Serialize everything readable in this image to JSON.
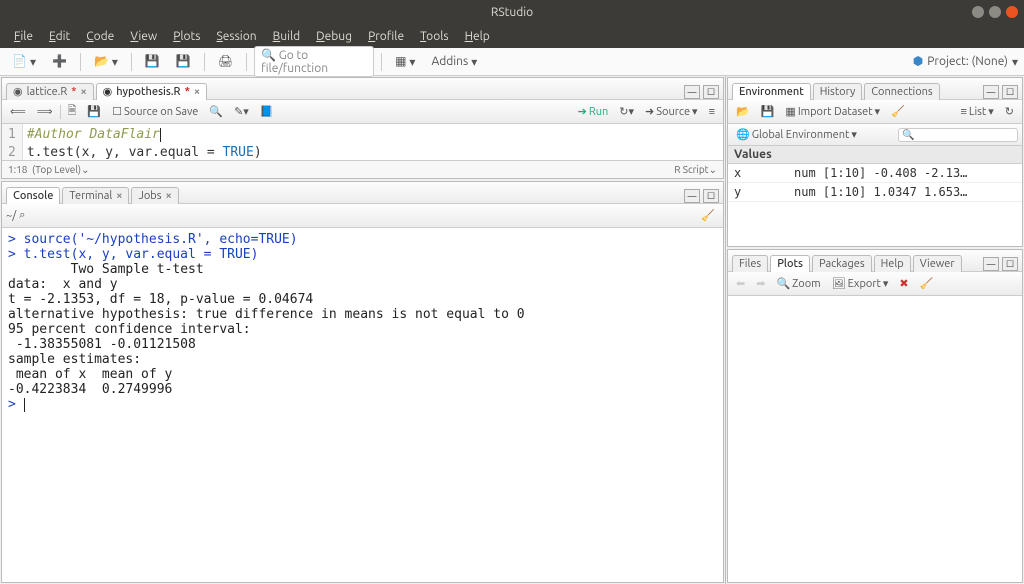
{
  "window": {
    "title": "RStudio"
  },
  "menu": [
    "File",
    "Edit",
    "Code",
    "View",
    "Plots",
    "Session",
    "Build",
    "Debug",
    "Profile",
    "Tools",
    "Help"
  ],
  "toolbar": {
    "goto_placeholder": "Go to file/function",
    "addins": "Addins",
    "project": "Project: (None)"
  },
  "source": {
    "tabs": [
      {
        "label": "lattice.R",
        "dirty": true,
        "active": false
      },
      {
        "label": "hypothesis.R",
        "dirty": true,
        "active": true
      }
    ],
    "panebar": {
      "source_on_save": "Source on Save",
      "run": "Run",
      "source_btn": "Source"
    },
    "lines": [
      {
        "n": "1",
        "cls": "comment",
        "text": "#Author DataFlair"
      },
      {
        "n": "2",
        "cls": "",
        "text": "t.test(x, y, var.equal = TRUE)"
      }
    ],
    "status_left": "1:18",
    "status_mid": "(Top Level)",
    "status_right": "R Script"
  },
  "console": {
    "tabs": [
      "Console",
      "Terminal",
      "Jobs"
    ],
    "prompt_path": "~/",
    "lines": [
      {
        "cls": "blue",
        "text": "> source('~/hypothesis.R', echo=TRUE)"
      },
      {
        "cls": "",
        "text": ""
      },
      {
        "cls": "blue",
        "text": "> t.test(x, y, var.equal = TRUE)"
      },
      {
        "cls": "",
        "text": ""
      },
      {
        "cls": "",
        "text": "\tTwo Sample t-test"
      },
      {
        "cls": "",
        "text": ""
      },
      {
        "cls": "",
        "text": "data:  x and y"
      },
      {
        "cls": "",
        "text": "t = -2.1353, df = 18, p-value = 0.04674"
      },
      {
        "cls": "",
        "text": "alternative hypothesis: true difference in means is not equal to 0"
      },
      {
        "cls": "",
        "text": "95 percent confidence interval:"
      },
      {
        "cls": "",
        "text": " -1.38355081 -0.01121508"
      },
      {
        "cls": "",
        "text": "sample estimates:"
      },
      {
        "cls": "",
        "text": " mean of x  mean of y "
      },
      {
        "cls": "",
        "text": "-0.4223834  0.2749996 "
      },
      {
        "cls": "",
        "text": ""
      },
      {
        "cls": "blue",
        "text": "> "
      }
    ]
  },
  "env": {
    "tabs": [
      "Environment",
      "History",
      "Connections"
    ],
    "import": "Import Dataset",
    "list": "List",
    "scope": "Global Environment",
    "search_placeholder": "",
    "section": "Values",
    "rows": [
      {
        "name": "x",
        "value": "num [1:10] -0.408 -2.13…"
      },
      {
        "name": "y",
        "value": "num [1:10] 1.0347 1.653…"
      }
    ]
  },
  "plots": {
    "tabs": [
      "Files",
      "Plots",
      "Packages",
      "Help",
      "Viewer"
    ],
    "zoom": "Zoom",
    "export": "Export"
  }
}
